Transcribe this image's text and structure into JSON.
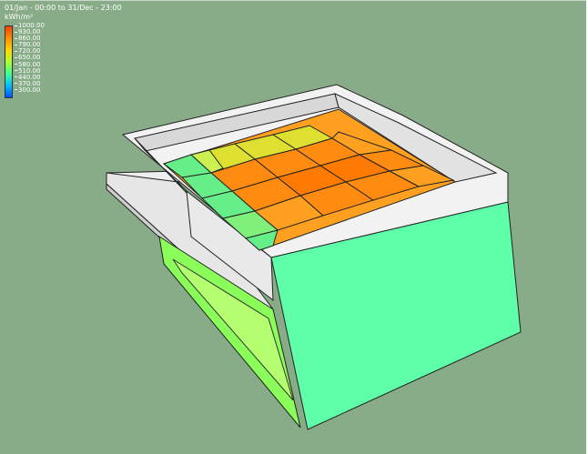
{
  "header": {
    "period_label": "01/Jan - 00:00 to 31/Dec - 23:00",
    "unit_label": "kWh/m²"
  },
  "legend": {
    "labels": [
      "1000.00",
      "930.00",
      "860.00",
      "790.00",
      "720.00",
      "650.00",
      "580.00",
      "510.00",
      "440.00",
      "370.00",
      "300.00"
    ],
    "colors": [
      "#ff4500",
      "#ff8c00",
      "#ffd700",
      "#adff2f",
      "#40ff90",
      "#00c0ff",
      "#0050ff"
    ]
  },
  "colors": {
    "background": "#88ab88",
    "parapet": "#e8e8e8",
    "wall_east": "#5fffaa",
    "wall_front": "#88ff55",
    "roof_high": "#ff8c10",
    "roof_mid": "#ffa820",
    "roof_low": "#dde030",
    "roof_edge": "#66ee88"
  }
}
